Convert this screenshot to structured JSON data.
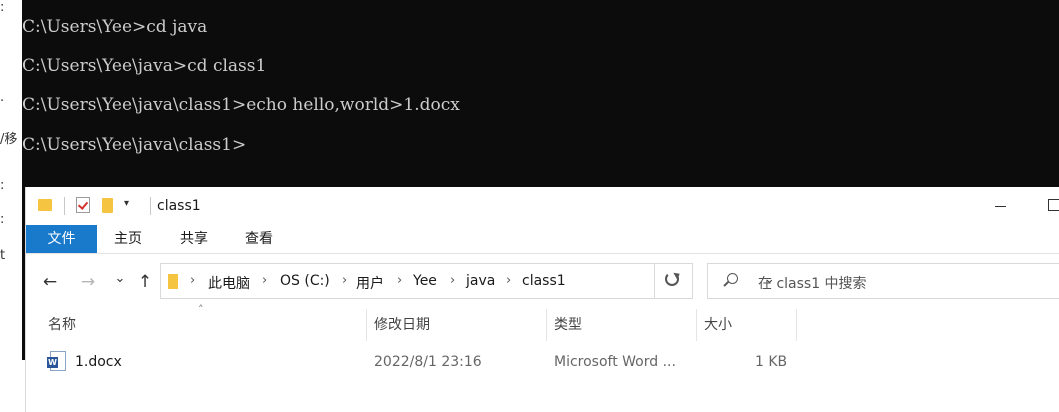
{
  "background_app": {
    "fragments": [
      ":",
      ".",
      "/移",
      ":",
      ":",
      "t"
    ]
  },
  "console": {
    "lines": [
      "C:\\Users\\Yee>cd java",
      "C:\\Users\\Yee\\java>cd class1",
      "C:\\Users\\Yee\\java\\class1>echo hello,world>1.docx",
      "C:\\Users\\Yee\\java\\class1>"
    ]
  },
  "explorer": {
    "title": "class1",
    "quick_access_dropdown": "▾",
    "ribbon_tabs": [
      "文件",
      "主页",
      "共享",
      "查看"
    ],
    "nav": {
      "back": "←",
      "forward": "→",
      "recent": "⌄",
      "up": "↑"
    },
    "breadcrumb": [
      "此电脑",
      "OS (C:)",
      "用户",
      "Yee",
      "java",
      "class1"
    ],
    "breadcrumb_separator": "›",
    "address_dropdown": "⌄",
    "search": {
      "placeholder": "在 class1 中搜索"
    },
    "columns": [
      "名称",
      "修改日期",
      "类型",
      "大小"
    ],
    "sort_indicator": "˄",
    "files": [
      {
        "name": "1.docx",
        "modified": "2022/8/1 23:16",
        "type": "Microsoft Word ...",
        "size": "1 KB",
        "icon": "word-doc-icon"
      }
    ]
  },
  "colors": {
    "console_bg": "#0c0c0c",
    "console_text": "#cccccc",
    "accent": "#1979ca",
    "folder": "#f5c542"
  }
}
